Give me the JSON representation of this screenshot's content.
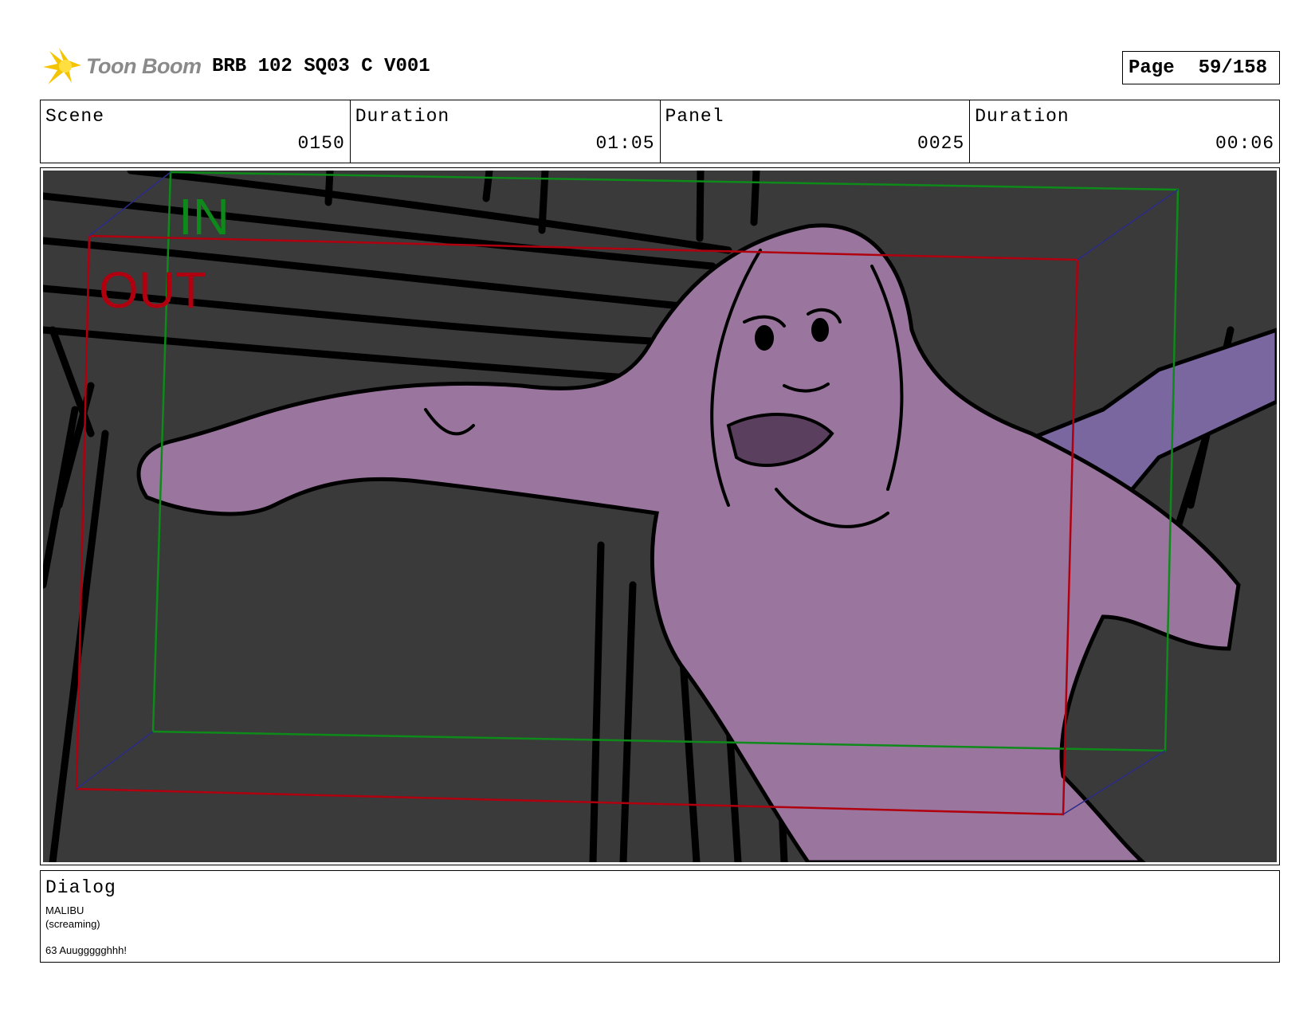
{
  "header": {
    "logo_text": "Toon Boom",
    "title": "BRB 102 SQ03 C V001",
    "page_label": "Page",
    "page_value": "59/158"
  },
  "info": {
    "scene_label": "Scene",
    "scene_value": "0150",
    "scene_duration_label": "Duration",
    "scene_duration_value": "01:05",
    "panel_label": "Panel",
    "panel_value": "0025",
    "panel_duration_label": "Duration",
    "panel_duration_value": "00:06"
  },
  "panel": {
    "in_label": "IN",
    "out_label": "OUT",
    "colors": {
      "background": "#3a3a3a",
      "character": "#9a769e",
      "hand": "#7a67a0",
      "in_frame": "#0e8a1a",
      "out_frame": "#b00010"
    }
  },
  "dialog": {
    "label": "Dialog",
    "character": "MALIBU",
    "direction": "(screaming)",
    "line": "63 Auuggggghhh!"
  }
}
